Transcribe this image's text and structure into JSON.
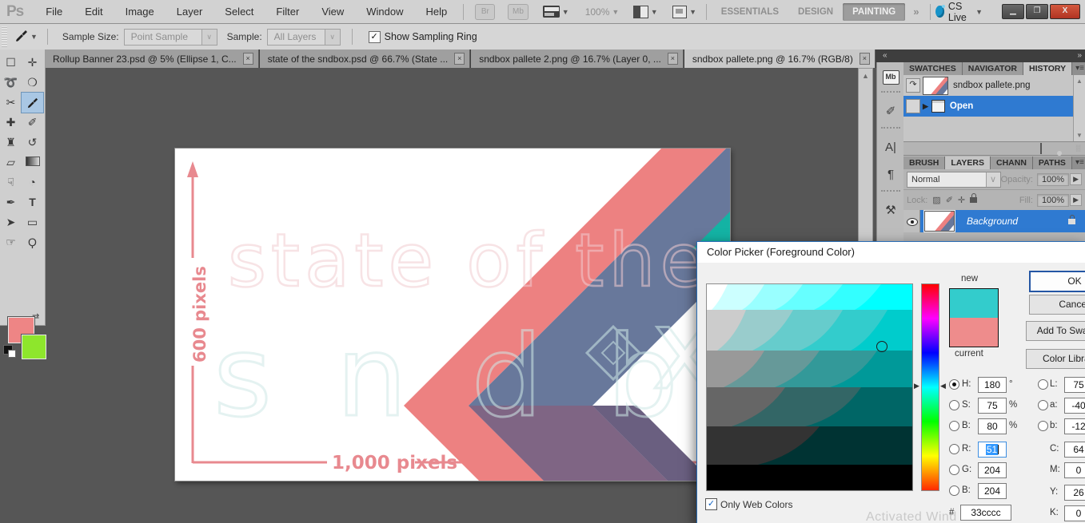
{
  "menu": {
    "logo": "Ps",
    "items": [
      "File",
      "Edit",
      "Image",
      "Layer",
      "Select",
      "Filter",
      "View",
      "Window",
      "Help"
    ]
  },
  "appbar": {
    "br": "Br",
    "mb": "Mb",
    "zoom_level": "100%",
    "workspaces": [
      "ESSENTIALS",
      "DESIGN",
      "PAINTING"
    ],
    "active_workspace": "PAINTING",
    "overflow_chevrons": "»",
    "cs_live": "CS Live",
    "window_buttons": {
      "minimize": "—",
      "restore": "❏",
      "close": "X"
    }
  },
  "options": {
    "sample_size_label": "Sample Size:",
    "sample_size_value": "Point Sample",
    "sample_label": "Sample:",
    "sample_value": "All Layers",
    "checkbox_glyph": "✓",
    "show_sampling_ring": "Show Sampling Ring"
  },
  "doc_tabs": {
    "tabs": [
      {
        "title": "Rollup Banner 23.psd @ 5% (Ellipse 1, C...",
        "close": "×"
      },
      {
        "title": "state of the sndbox.psd @ 66.7% (State ...",
        "close": "×"
      },
      {
        "title": "sndbox pallete 2.png @ 16.7% (Layer 0, ...",
        "close": "×"
      },
      {
        "title": "sndbox pallete.png @ 16.7% (RGB/8)",
        "close": "×"
      }
    ],
    "active_index": 3
  },
  "toolbar": {
    "tools": [
      "rectangular-marquee",
      "move",
      "lasso",
      "quick-selection",
      "crop",
      "eyedropper",
      "healing-brush",
      "brush",
      "clone-stamp",
      "history-brush",
      "eraser",
      "gradient",
      "smudge",
      "dodge",
      "pen",
      "type",
      "path-selection",
      "rectangle",
      "hand",
      "zoom"
    ],
    "foreground_color": "#ee8585",
    "background_color": "#8ee62c"
  },
  "canvas": {
    "outline_title": "state of the",
    "word": "s n d b",
    "letter_x": "x",
    "dim_height": "600 pixels",
    "dim_width": "1,000 pixels",
    "colors": {
      "pink": "#ed8181",
      "slate": "#68789b",
      "teal": "#14b3a4",
      "overlap_mauve": "#7f6584",
      "overlap_dark": "#6a5f80",
      "annotation_pink": "#e8898f"
    }
  },
  "dock": {
    "collapse_left": "«",
    "collapse_right": "»"
  },
  "history_panel": {
    "tabs": [
      "SWATCHES",
      "NAVIGATOR",
      "HISTORY"
    ],
    "active_tab": "HISTORY",
    "menu_icon": "▾≡",
    "snapshot_label": "sndbox pallete.png",
    "state_label": "Open",
    "source_glyph": "↷",
    "state_arrow": "▶"
  },
  "layers_panel": {
    "tabs": [
      "BRUSH",
      "LAYERS",
      "CHANN",
      "PATHS"
    ],
    "active_tab": "LAYERS",
    "menu_icon": "▾≡",
    "blend_mode": "Normal",
    "opacity_label": "Opacity:",
    "opacity_value": "100%",
    "lock_label": "Lock:",
    "fill_label": "Fill:",
    "fill_value": "100%",
    "layer_name": "Background"
  },
  "color_picker": {
    "title": "Color Picker (Foreground Color)",
    "new_label": "new",
    "current_label": "current",
    "new_color": "#33cccc",
    "current_color": "#ee8c8c",
    "buttons": {
      "ok": "OK",
      "cancel": "Cancel",
      "add_to_swatches": "Add To Swatches",
      "color_libraries": "Color Libraries"
    },
    "fields": {
      "H": {
        "label": "H:",
        "value": "180",
        "unit": "°"
      },
      "S": {
        "label": "S:",
        "value": "75",
        "unit": "%"
      },
      "B": {
        "label": "B:",
        "value": "80",
        "unit": "%"
      },
      "R": {
        "label": "R:",
        "value": "51"
      },
      "G": {
        "label": "G:",
        "value": "204"
      },
      "B2": {
        "label": "B:",
        "value": "204"
      },
      "L": {
        "label": "L:",
        "value": "75"
      },
      "a": {
        "label": "a:",
        "value": "-40"
      },
      "b": {
        "label": "b:",
        "value": "-12"
      },
      "C": {
        "label": "C:",
        "value": "64"
      },
      "M": {
        "label": "M:",
        "value": "0"
      },
      "Y": {
        "label": "Y:",
        "value": "26"
      },
      "K": {
        "label": "K:",
        "value": "0"
      }
    },
    "hex_label": "#",
    "hex_value": "33cccc",
    "only_web_colors": "Only Web Colors",
    "checkbox_glyph": "✓"
  },
  "watermark": "Activated Wind"
}
